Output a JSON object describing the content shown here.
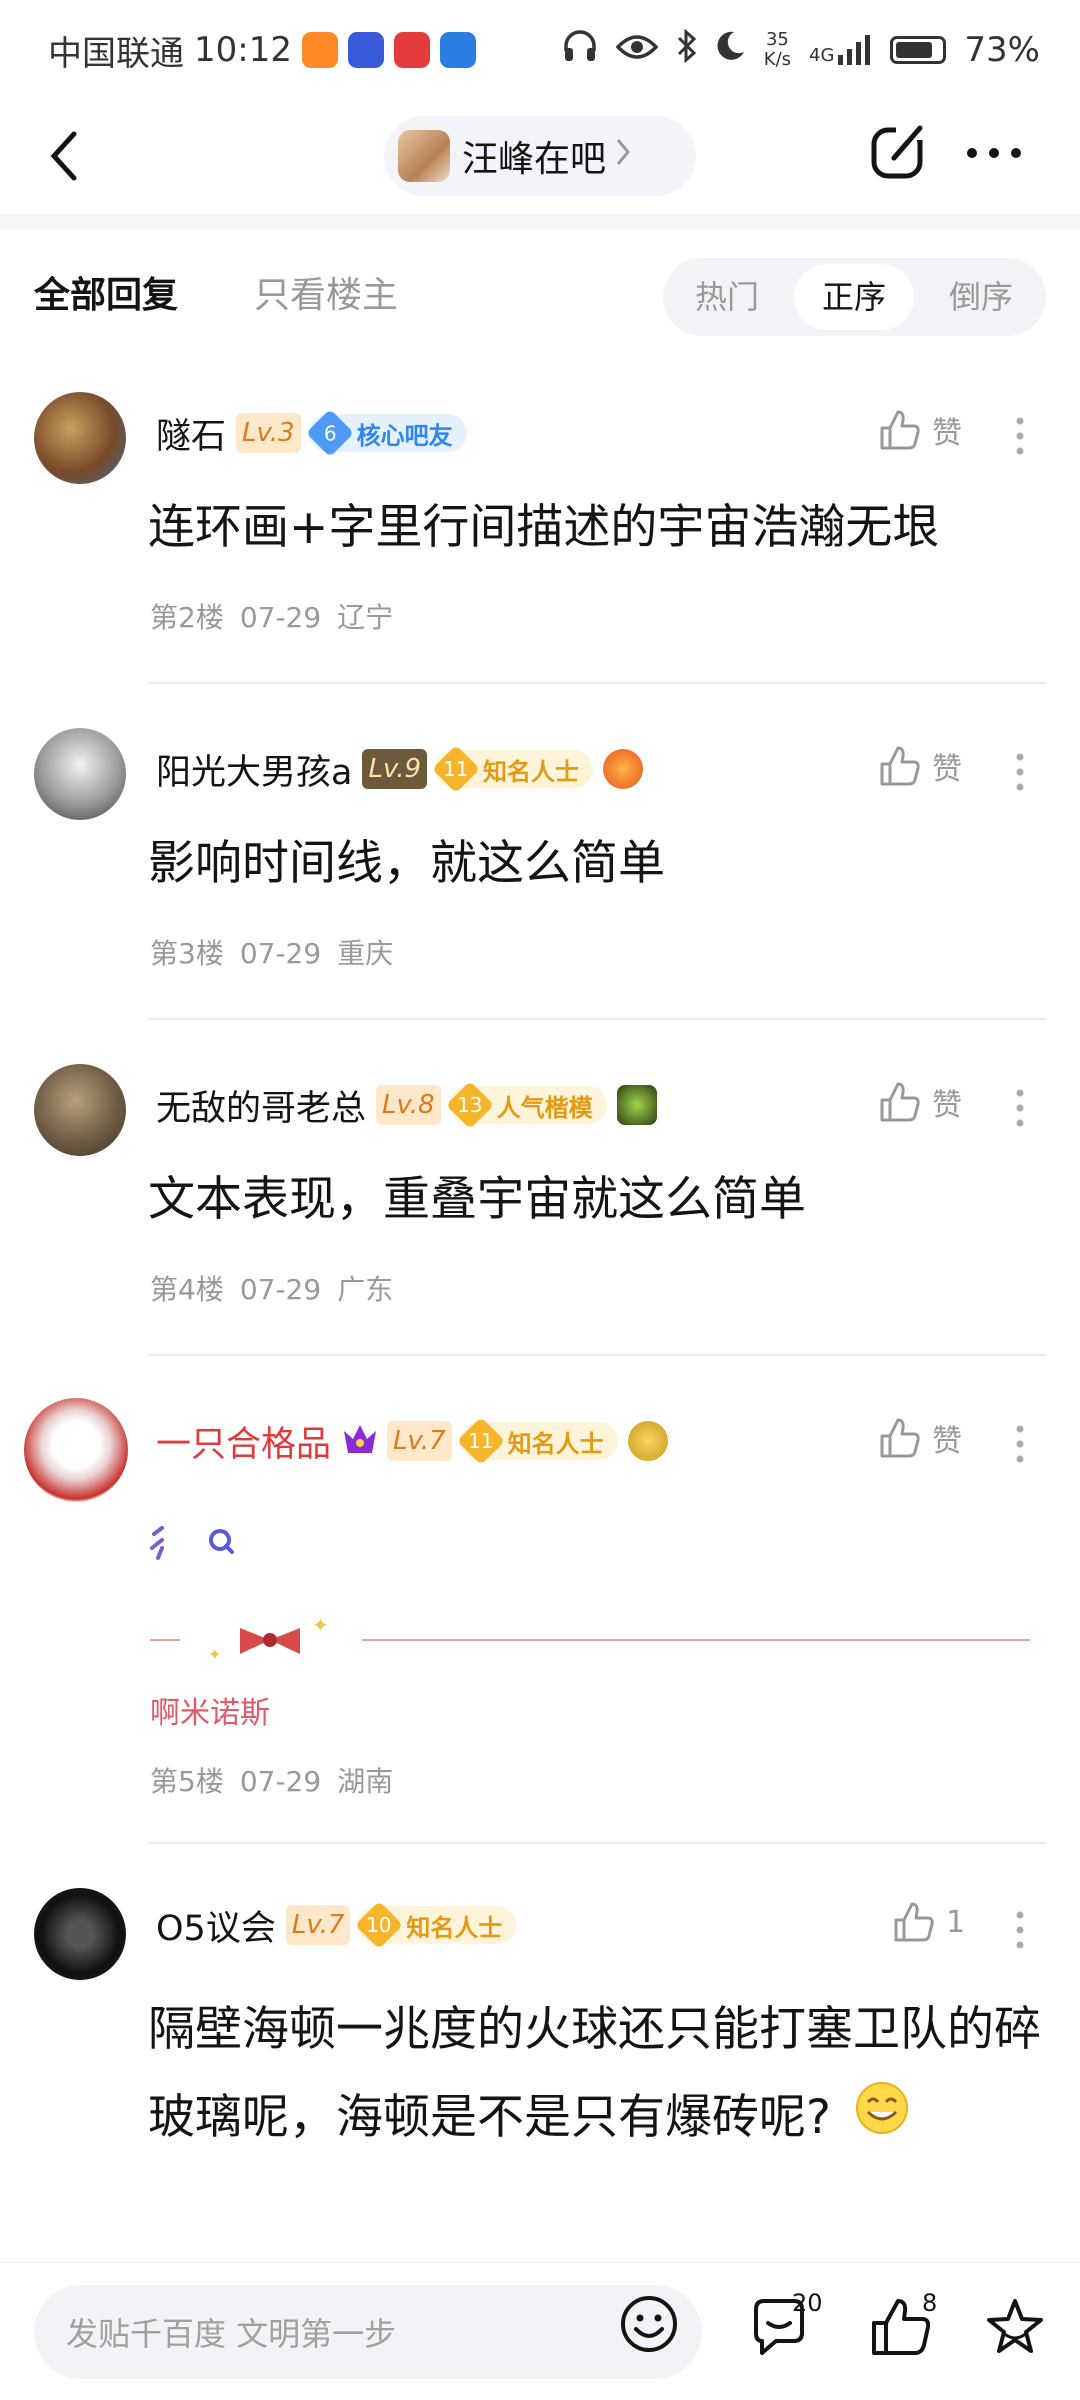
{
  "status_bar": {
    "carrier": "中国联通",
    "time": "10:12",
    "net_speed_value": "35",
    "net_speed_unit": "K/s",
    "network": "4G",
    "battery": "73%"
  },
  "nav": {
    "forum_name": "汪峰在吧"
  },
  "tabs": {
    "all_replies": "全部回复",
    "op_only": "只看楼主",
    "sort": [
      "热门",
      "正序",
      "倒序"
    ],
    "active_sort": "正序"
  },
  "posts": [
    {
      "username": "隧石",
      "level": "Lv.3",
      "badge_num": "6",
      "badge_title": "核心吧友",
      "like_label": "赞",
      "content": "连环画+字里行间描述的宇宙浩瀚无垠",
      "floor": "第2楼",
      "date": "07-29",
      "location": "辽宁"
    },
    {
      "username": "阳光大男孩a",
      "level": "Lv.9",
      "badge_num": "11",
      "badge_title": "知名人士",
      "like_label": "赞",
      "content": "影响时间线，就这么简单",
      "floor": "第3楼",
      "date": "07-29",
      "location": "重庆"
    },
    {
      "username": "无敌的哥老总",
      "level": "Lv.8",
      "badge_num": "13",
      "badge_title": "人气楷模",
      "like_label": "赞",
      "content": "文本表现，重叠宇宙就这么简单",
      "floor": "第4楼",
      "date": "07-29",
      "location": "广东"
    },
    {
      "username": "一只合格品",
      "level": "Lv.7",
      "badge_num": "11",
      "badge_title": "知名人士",
      "like_label": "赞",
      "signature": "啊米诺斯",
      "floor": "第5楼",
      "date": "07-29",
      "location": "湖南"
    },
    {
      "username": "O5议会",
      "level": "Lv.7",
      "badge_num": "10",
      "badge_title": "知名人士",
      "like_label": "1",
      "content": "隔壁海顿一兆度的火球还只能打塞卫队的碎玻璃呢，海顿是不是只有爆砖呢?"
    }
  ],
  "bottom_bar": {
    "input_placeholder": "发贴千百度 文明第一步",
    "comment_count": "20",
    "like_count": "8"
  },
  "colors": {
    "accent_red": "#e03a3a",
    "badge_blue": "#2f86f0",
    "badge_gold": "#e29a12",
    "muted_text": "#999999"
  }
}
